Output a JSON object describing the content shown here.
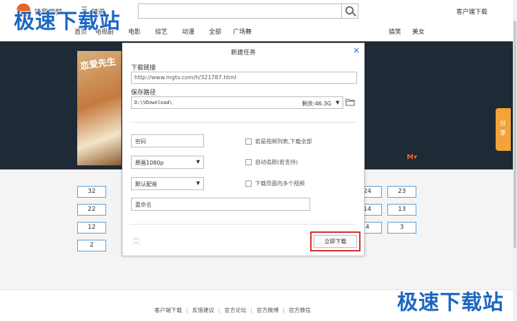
{
  "header": {
    "logo_text": "锋掌视频",
    "menu_label": "频道",
    "client_download": "客户端下载",
    "nav_items": [
      "首页",
      "电视剧",
      "电影",
      "综艺",
      "动漫",
      "全部",
      "广场舞"
    ],
    "nav_right_items": [
      "搞笑",
      "美女"
    ],
    "watermark": "极速下载站"
  },
  "banner": {
    "poster_title": "恋爱先生",
    "brand_logo": "M▾"
  },
  "share_tab": "分享",
  "episodes": [
    "32",
    "22",
    "12",
    "2",
    "24",
    "23",
    "14",
    "13",
    "4",
    "3"
  ],
  "dialog": {
    "title": "新建任务",
    "close": "×",
    "url_label": "下载链接",
    "url_value": "http://www.mgtv.com/h/321787.html",
    "path_label": "保存路径",
    "path_value": "D:\\VDownload\\",
    "remaining": "剩余:46.3G",
    "password_placeholder": "密码",
    "quality_value": "原画1080p",
    "audio_value": "默认配音",
    "rename_placeholder": "重命名",
    "checkbox_download_all": "若是视频列表,下载全部",
    "checkbox_auto_follow": "自动追剧(若支持)",
    "checkbox_multi_video": "下载页面内多个视频",
    "download_button": "立即下载"
  },
  "footer": {
    "links": [
      "客户端下载",
      "反馈建议",
      "官方论坛",
      "官方微博",
      "官方微信"
    ],
    "separator": "|",
    "watermark": "极速下载站"
  },
  "colors": {
    "accent": "#1b67c2",
    "brand": "#e8641f",
    "banner_bg": "#1e2a36",
    "share_tab": "#f3a33a",
    "highlight": "#d62a2a"
  }
}
